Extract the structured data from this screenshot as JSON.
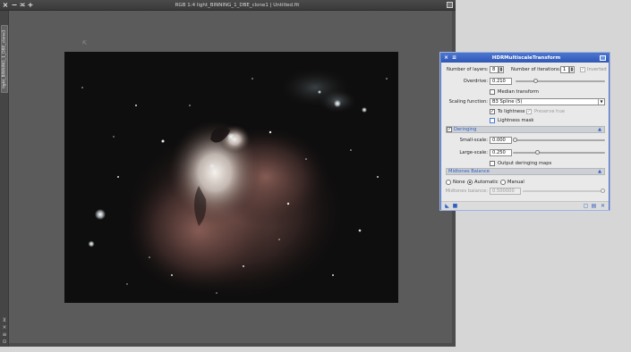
{
  "window": {
    "title": "RGB 1:4 light_BINNING_1_DBE_clone1 | Untitled.fit",
    "view_tab_label": "light_BINNING_1_DBE_clone1"
  },
  "dialog": {
    "title": "HDRMultiscaleTransform",
    "number_of_layers": {
      "label": "Number of layers:",
      "value": "8"
    },
    "number_of_iterations": {
      "label": "Number of iterations:",
      "value": "1"
    },
    "inverted": {
      "label": "Inverted",
      "checked": false
    },
    "overdrive": {
      "label": "Overdrive:",
      "value": "0.210",
      "fraction": 0.21
    },
    "median_transform": {
      "label": "Median transform",
      "checked": false
    },
    "scaling_function": {
      "label": "Scaling function:",
      "value": "B3 Spline (5)"
    },
    "to_lightness": {
      "label": "To lightness",
      "checked": true
    },
    "preserve_hue": {
      "label": "Preserve hue",
      "checked": true,
      "disabled": true
    },
    "lightness_mask": {
      "label": "Lightness mask",
      "checked": false
    },
    "deringing": {
      "label": "Deringing",
      "enabled": true,
      "small_scale": {
        "label": "Small-scale:",
        "value": "0.000",
        "fraction": 0.0
      },
      "large_scale": {
        "label": "Large-scale:",
        "value": "0.250",
        "fraction": 0.25
      },
      "output_maps": {
        "label": "Output deringing maps",
        "checked": false
      }
    },
    "midtones": {
      "label": "Midtones Balance",
      "none_label": "None",
      "automatic_label": "Automatic",
      "manual_label": "Manual",
      "selected": "Automatic",
      "balance": {
        "label": "Midtones balance:",
        "value": "0.500000",
        "fraction": 1.0
      }
    }
  },
  "icons": {
    "close": "×",
    "shade": "≡",
    "collapse": "▲",
    "combo_arrow": "▼",
    "check": "✓",
    "cursor": "⇱"
  },
  "colors": {
    "dialog_titlebar": "#3a63c4",
    "section_header_text": "#2f5fc4",
    "image_window_bg": "#5b5b5b"
  }
}
